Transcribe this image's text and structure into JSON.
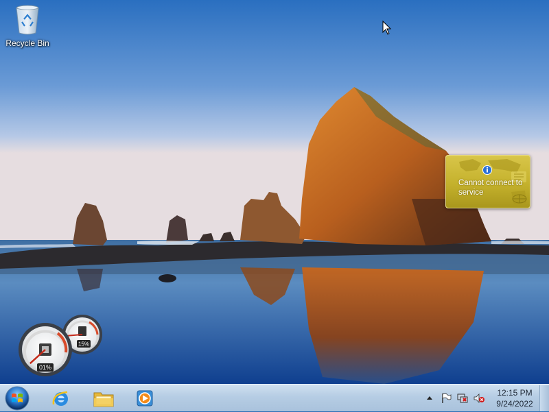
{
  "desktop": {
    "icons": [
      {
        "label": "Recycle Bin",
        "icon": "recycle-bin-icon"
      }
    ]
  },
  "gadgets": {
    "weather": {
      "message": "Cannot connect to service",
      "icon": "info-icon"
    },
    "cpu_meter": {
      "cpu_label": "01%",
      "memory_label": "15%",
      "cpu_percent": 1,
      "memory_percent": 15
    }
  },
  "taskbar": {
    "start": {
      "icon": "windows-logo-icon"
    },
    "pinned": [
      {
        "name": "Internet Explorer",
        "icon": "internet-explorer-icon"
      },
      {
        "name": "Windows Explorer",
        "icon": "folder-icon"
      },
      {
        "name": "Windows Media Player",
        "icon": "media-player-icon"
      }
    ],
    "tray": {
      "icons": [
        "show-hidden-icons-chevron",
        "action-center-flag-icon",
        "network-icon",
        "volume-muted-icon"
      ],
      "time": "12:15 PM",
      "date": "9/24/2022"
    }
  },
  "colors": {
    "sky_top": "#2a6fc0",
    "sky_bottom": "#e6dde0",
    "rock": "#9c4d18",
    "taskbar": "#b6cde4",
    "weather_gadget": "#c4b12c"
  }
}
